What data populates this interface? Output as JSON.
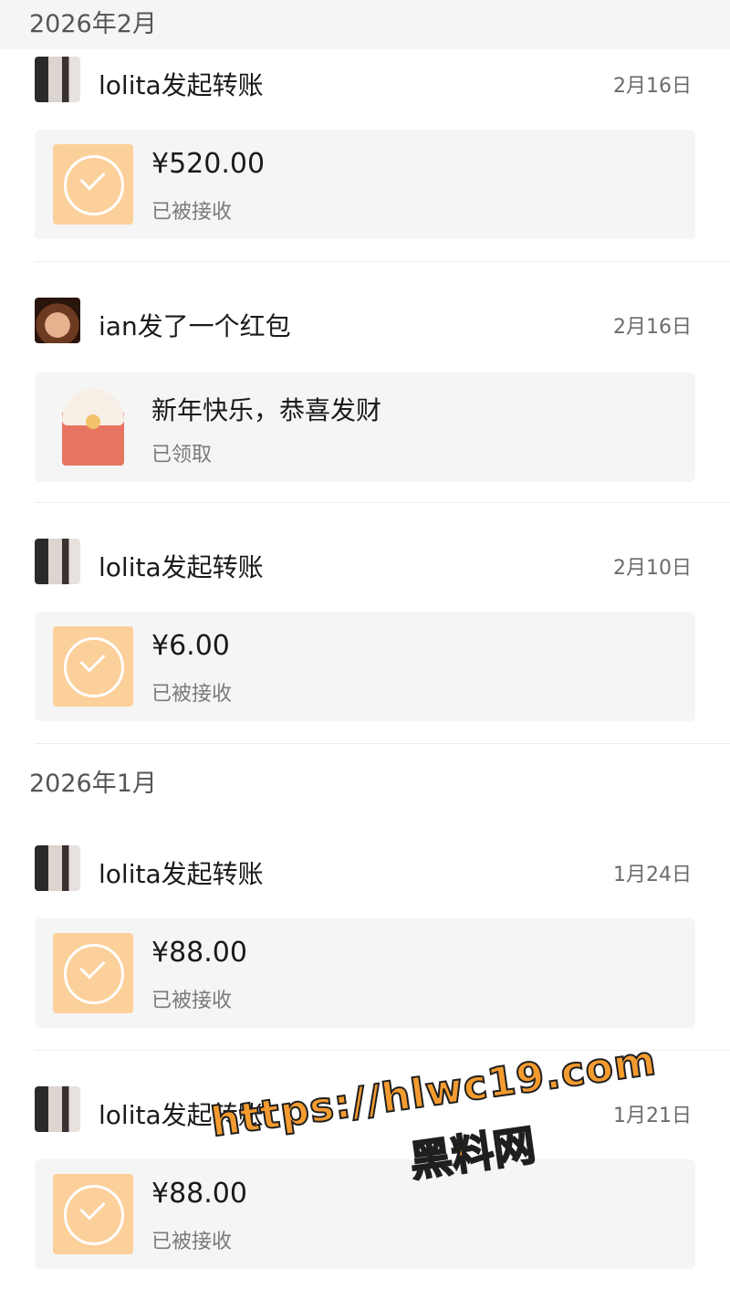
{
  "sections": [
    {
      "month": "2026年2月",
      "items": [
        {
          "sender": "lolita发起转账",
          "date": "2月16日",
          "amount": "¥520.00",
          "status": "已被接收"
        },
        {
          "sender": "ian发了一个红包",
          "date": "2月16日",
          "message": "新年快乐，恭喜发财",
          "status": "已领取"
        },
        {
          "sender": "lolita发起转账",
          "date": "2月10日",
          "amount": "¥6.00",
          "status": "已被接收"
        }
      ]
    },
    {
      "month": "2026年1月",
      "items": [
        {
          "sender": "lolita发起转账",
          "date": "1月24日",
          "amount": "¥88.00",
          "status": "已被接收"
        },
        {
          "sender": "lolita发起转账",
          "date": "1月21日",
          "amount": "¥88.00",
          "status": "已被接收"
        }
      ]
    }
  ],
  "watermark": {
    "url": "https://hlwc19.com",
    "text": "黑料网"
  },
  "icons": {
    "transfer": "check-circle-icon",
    "red_packet": "red-envelope-icon"
  },
  "colors": {
    "transfer_icon_bg": "#fcd09a",
    "red_packet": "#e87561",
    "watermark": "#f49b2f"
  }
}
